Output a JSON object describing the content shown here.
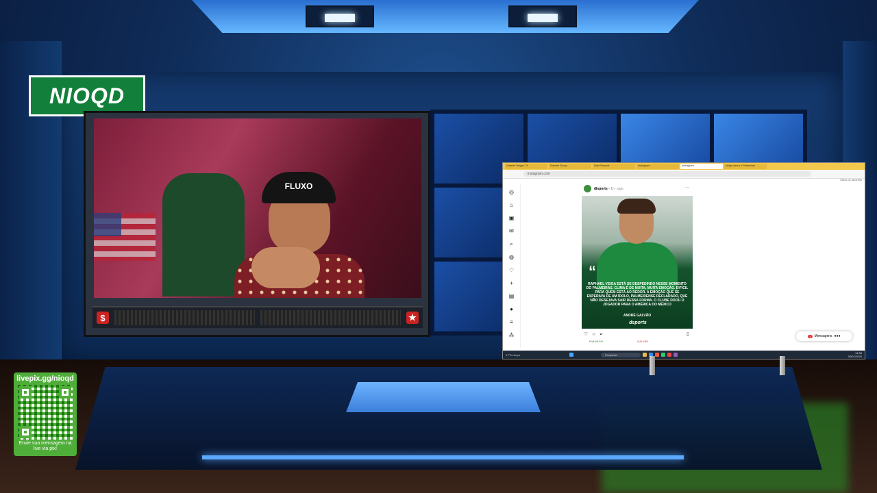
{
  "logo": {
    "text": "NIOQD",
    "color": "#12803a"
  },
  "webcam": {
    "cap_text": "FLUXO",
    "left_icon": "$",
    "right_icon": "★"
  },
  "browser": {
    "tabs": [
      "Gabriel Veiga | Th",
      "Gabriel Grupo",
      "Dahl Repeat",
      "Instagram",
      "Instagram",
      "Veiga deixa o Palmeiras"
    ],
    "active_tab_index": 4,
    "url": "instagram.com",
    "bookmarks_label": "Todos os favoritos",
    "post": {
      "username": "dlsports",
      "time": "• 1h · ago",
      "quote": "RAPHAEL VEIGA ESTÁ SE DESPEDINDO NESSE MOMENTO DO PALMEIRAS. CLIMA É DE MUITA, MUITA EMOÇÃO. DIFÍCIL PARA QUEM ESTÁ AO REDOR. A EMOÇÃO QUE SE ESPERAVA DE UM ÍDOLO, PALMEIRENSE DECLARADO, QUE NÃO DESEJAVA SAIR DESSA FORMA. O CLUBE DOOU O JOGADOR PARA O AMÉRICA DO MÉXICO",
      "author": "ANDRÉ GALVÃO",
      "brand": "dsports",
      "tag_left": "EVANILDO",
      "tag_right": "GALVÃO"
    },
    "messages_label": "Mensagens",
    "messages_badge": "1",
    "taskbar": {
      "weather": "17°C  Limpo",
      "search_placeholder": "Pesquisar",
      "time": "14:58",
      "date": "09/01/2025"
    }
  },
  "livepix": {
    "url": "livepix.gg/nioqd",
    "text": "Envie sua mensagem na live via pix!"
  }
}
